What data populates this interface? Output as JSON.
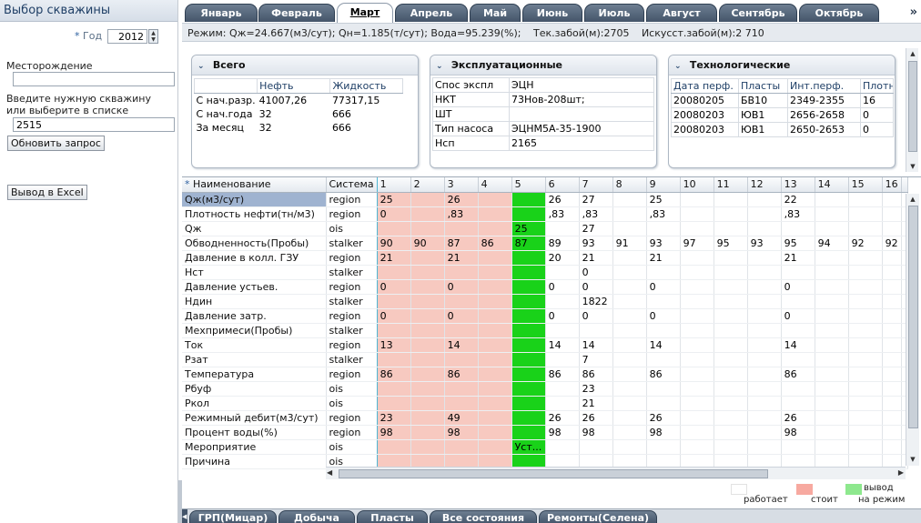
{
  "left_panel": {
    "title": "Выбор скважины",
    "year_star": "*",
    "year_label": "Год",
    "year_value": "2012",
    "field_label": "Месторождение",
    "field_value": "",
    "well_label_1": "Введите нужную скважину",
    "well_label_2": "или выберите в списке",
    "well_value": "2515",
    "refresh_button": "Обновить запрос",
    "excel_button": "Вывод в Excel"
  },
  "month_tabs": [
    "Январь",
    "Февраль",
    "Март",
    "Апрель",
    "Май",
    "Июнь",
    "Июль",
    "Август",
    "Сентябрь",
    "Октябрь"
  ],
  "active_month": "Март",
  "more_tabs": "»",
  "status": {
    "mode": "Режим: Qж=24.667(м3/сут); Qн=1.185(т/сут); Вода=95.239(%);",
    "bottom": "Тек.забой(м):2705",
    "art_bottom": "Искусст.забой(м):2 710"
  },
  "panels": {
    "total": {
      "title": "Всего",
      "headers": [
        "",
        "Нефть",
        "Жидкость"
      ],
      "rows": [
        [
          "С нач.разр.",
          "41007,26",
          "77317,15"
        ],
        [
          "С нач.года",
          "32",
          "666"
        ],
        [
          "За месяц",
          "32",
          "666"
        ]
      ]
    },
    "operational": {
      "title": "Эксплуатационные",
      "rows": [
        [
          "Спос экспл",
          "ЭЦН"
        ],
        [
          "НКТ",
          "73Нов-208шт;"
        ],
        [
          "ШТ",
          ""
        ],
        [
          "Тип насоса",
          "ЭЦНМ5А-35-1900"
        ],
        [
          "Нсп",
          "2165"
        ]
      ]
    },
    "technological": {
      "title": "Технологические",
      "headers": [
        "Дата перф.",
        "Пласты",
        "Инт.перф.",
        "Плотн"
      ],
      "rows": [
        [
          "20080205",
          "БВ10",
          "2349-2355",
          "16"
        ],
        [
          "20080203",
          "ЮВ1",
          "2656-2658",
          "0"
        ],
        [
          "20080203",
          "ЮВ1",
          "2650-2653",
          "0"
        ]
      ]
    }
  },
  "grid": {
    "header_star": "*",
    "col_name": "Наименование",
    "col_system": "Система",
    "days": [
      "1",
      "2",
      "3",
      "4",
      "5",
      "6",
      "7",
      "8",
      "9",
      "10",
      "11",
      "12",
      "13",
      "14",
      "15",
      "16"
    ],
    "day_status": [
      "stop",
      "stop",
      "stop",
      "stop",
      "green",
      "work",
      "work",
      "work",
      "work",
      "work",
      "work",
      "work",
      "work",
      "work",
      "work",
      "work"
    ],
    "rows": [
      {
        "name": "Qж(м3/сут)",
        "system": "region",
        "values": [
          "25",
          "",
          "26",
          "",
          "",
          "26",
          "27",
          "",
          "25",
          "",
          "",
          "",
          "22",
          "",
          "",
          ""
        ]
      },
      {
        "name": "Плотность нефти(тн/м3)",
        "system": "region",
        "values": [
          "0",
          "",
          ",83",
          "",
          "",
          ",83",
          ",83",
          "",
          ",83",
          "",
          "",
          "",
          ",83",
          "",
          "",
          ""
        ]
      },
      {
        "name": "Qж",
        "system": "ois",
        "values": [
          "",
          "",
          "",
          "",
          "25",
          "",
          "27",
          "",
          "",
          "",
          "",
          "",
          "",
          "",
          "",
          ""
        ]
      },
      {
        "name": "Обводненность(Пробы)",
        "system": "stalker",
        "values": [
          "90",
          "90",
          "87",
          "86",
          "87",
          "89",
          "93",
          "91",
          "93",
          "97",
          "95",
          "93",
          "95",
          "94",
          "92",
          "92"
        ]
      },
      {
        "name": "Давление в колл. ГЗУ",
        "system": "region",
        "values": [
          "21",
          "",
          "21",
          "",
          "",
          "20",
          "21",
          "",
          "21",
          "",
          "",
          "",
          "21",
          "",
          "",
          ""
        ]
      },
      {
        "name": "Нст",
        "system": "stalker",
        "values": [
          "",
          "",
          "",
          "",
          "",
          "",
          "0",
          "",
          "",
          "",
          "",
          "",
          "",
          "",
          "",
          ""
        ]
      },
      {
        "name": "Давление устьев.",
        "system": "region",
        "values": [
          "0",
          "",
          "0",
          "",
          "",
          "0",
          "0",
          "",
          "0",
          "",
          "",
          "",
          "0",
          "",
          "",
          ""
        ]
      },
      {
        "name": "Ндин",
        "system": "stalker",
        "values": [
          "",
          "",
          "",
          "",
          "",
          "",
          "1822",
          "",
          "",
          "",
          "",
          "",
          "",
          "",
          "",
          ""
        ]
      },
      {
        "name": "Давление затр.",
        "system": "region",
        "values": [
          "0",
          "",
          "0",
          "",
          "",
          "0",
          "0",
          "",
          "0",
          "",
          "",
          "",
          "0",
          "",
          "",
          ""
        ]
      },
      {
        "name": "Мехпримеси(Пробы)",
        "system": "stalker",
        "values": [
          "",
          "",
          "",
          "",
          "",
          "",
          "",
          "",
          "",
          "",
          "",
          "",
          "",
          "",
          "",
          ""
        ]
      },
      {
        "name": "Ток",
        "system": "region",
        "values": [
          "13",
          "",
          "14",
          "",
          "",
          "14",
          "14",
          "",
          "14",
          "",
          "",
          "",
          "14",
          "",
          "",
          ""
        ]
      },
      {
        "name": "Рзат",
        "system": "stalker",
        "values": [
          "",
          "",
          "",
          "",
          "",
          "",
          "7",
          "",
          "",
          "",
          "",
          "",
          "",
          "",
          "",
          ""
        ]
      },
      {
        "name": "Температура",
        "system": "region",
        "values": [
          "86",
          "",
          "86",
          "",
          "",
          "86",
          "86",
          "",
          "86",
          "",
          "",
          "",
          "86",
          "",
          "",
          ""
        ]
      },
      {
        "name": "Рбуф",
        "system": "ois",
        "values": [
          "",
          "",
          "",
          "",
          "",
          "",
          "23",
          "",
          "",
          "",
          "",
          "",
          "",
          "",
          "",
          ""
        ]
      },
      {
        "name": "Ркол",
        "system": "ois",
        "values": [
          "",
          "",
          "",
          "",
          "",
          "",
          "21",
          "",
          "",
          "",
          "",
          "",
          "",
          "",
          "",
          ""
        ]
      },
      {
        "name": "Режимный дебит(м3/сут)",
        "system": "region",
        "values": [
          "23",
          "",
          "49",
          "",
          "",
          "26",
          "26",
          "",
          "26",
          "",
          "",
          "",
          "26",
          "",
          "",
          ""
        ]
      },
      {
        "name": "Процент воды(%)",
        "system": "region",
        "values": [
          "98",
          "",
          "98",
          "",
          "",
          "98",
          "98",
          "",
          "98",
          "",
          "",
          "",
          "98",
          "",
          "",
          ""
        ]
      },
      {
        "name": "Мероприятие",
        "system": "ois",
        "values": [
          "",
          "",
          "",
          "",
          "Уст...",
          "",
          "",
          "",
          "",
          "",
          "",
          "",
          "",
          "",
          "",
          ""
        ]
      },
      {
        "name": "Причина",
        "system": "ois",
        "values": [
          "",
          "",
          "",
          "",
          "",
          "",
          "",
          "",
          "",
          "",
          "",
          "",
          "",
          "",
          "",
          ""
        ]
      }
    ]
  },
  "legend": {
    "work": "работает",
    "stop": "стоит",
    "green_1": "вывод",
    "green_2": "на режим"
  },
  "bottom_tabs": [
    "ГРП(Мицар)",
    "Добыча",
    "Пласты",
    "Все состояния",
    "Ремонты(Селена)"
  ],
  "colors": {
    "stop": "#f7c9c0",
    "green": "#19d219",
    "work": "#ffffff",
    "tab_dark": "#44556a"
  }
}
